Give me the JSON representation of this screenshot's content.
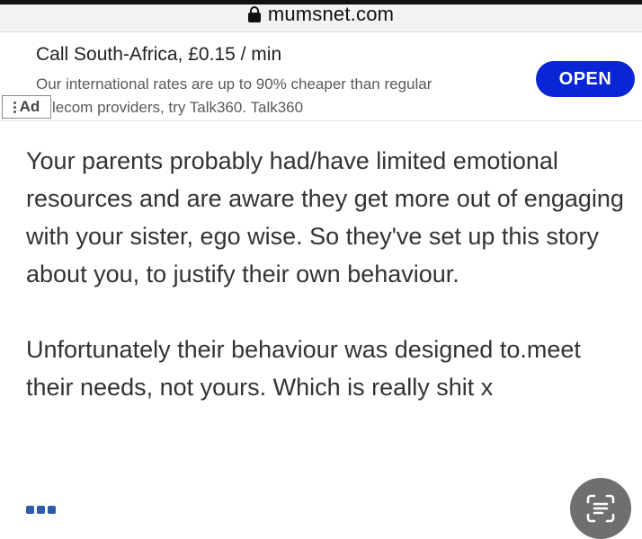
{
  "browser": {
    "url": "mumsnet.com"
  },
  "ad": {
    "title": "Call South-Africa, £0.15 / min",
    "description_line1": "Our international rates are up to 90% cheaper than regular",
    "description_line2": "lecom providers, try Talk360.",
    "brand": "Talk360",
    "badge_label": "Ad",
    "cta_label": "OPEN",
    "cta_color": "#0a25d6"
  },
  "post": {
    "paragraphs": [
      "Your parents probably had/have limited emotional resources and are aware they get more out of engaging with your sister, ego wise. So they've set up this story about you, to justify their own behaviour.",
      "Unfortunately their behaviour was designed to.meet their needs, not yours. Which is really shit x"
    ]
  },
  "icons": {
    "lock": "lock-icon",
    "more": "more-dots-icon",
    "scan": "text-scan-icon"
  }
}
